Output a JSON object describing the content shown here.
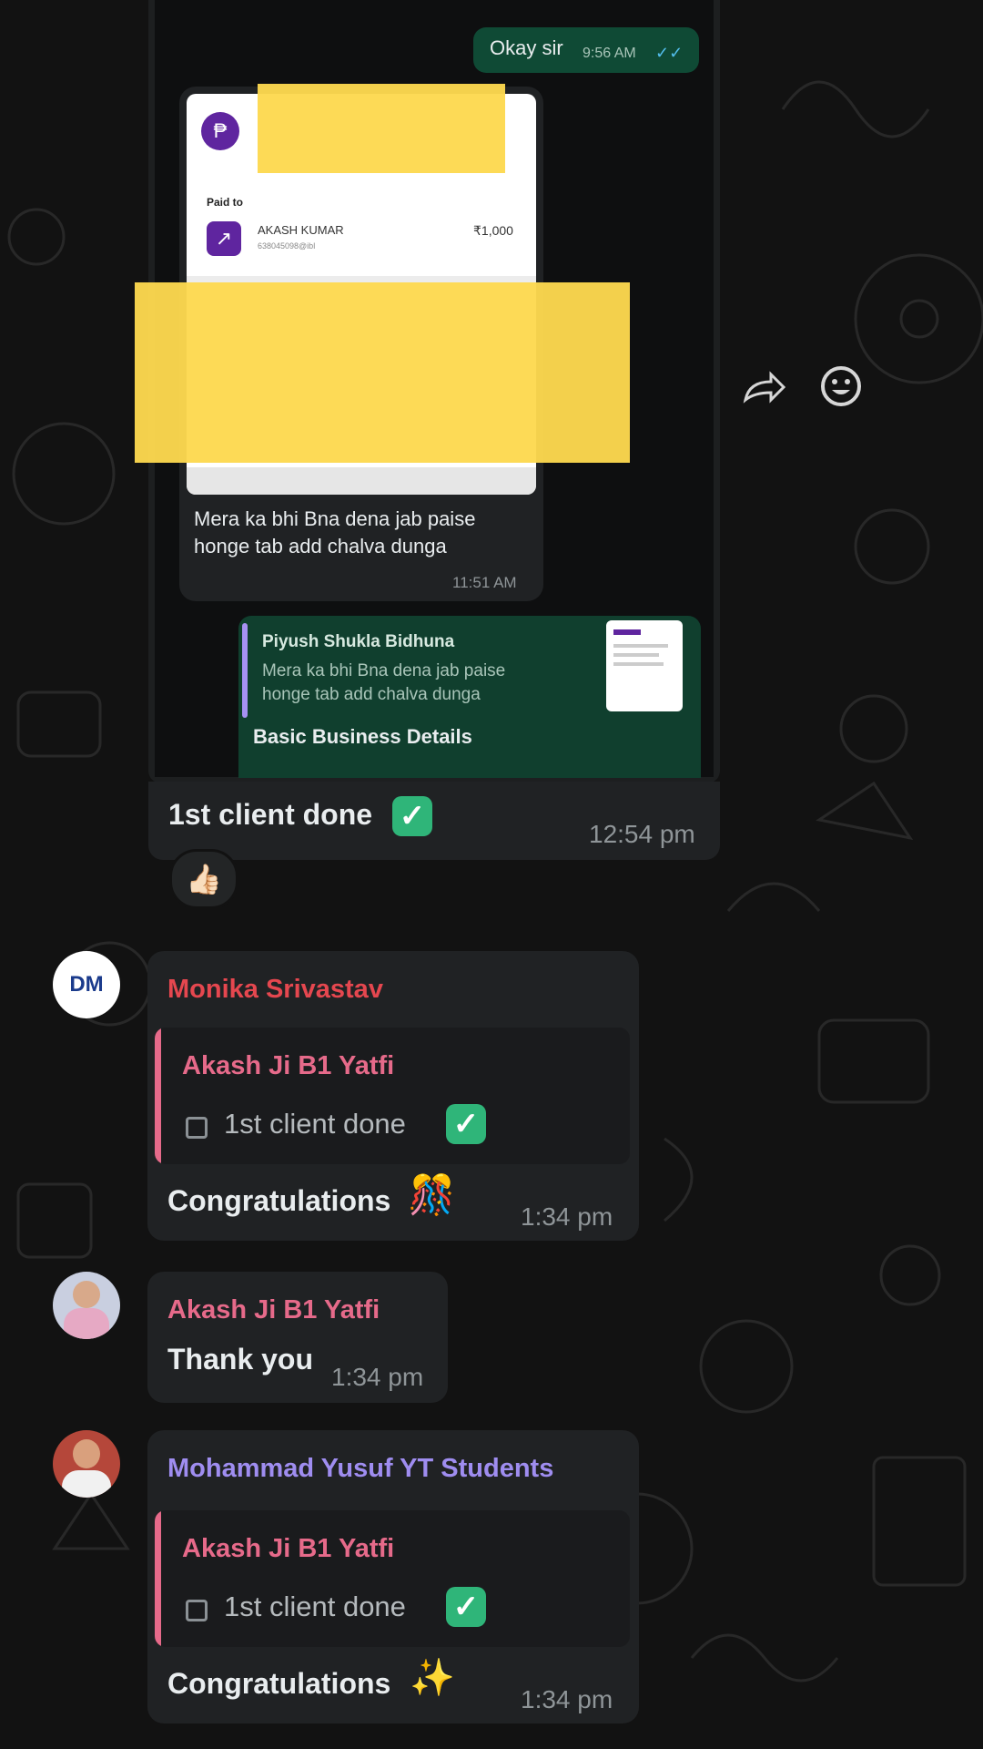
{
  "top_message": {
    "text": "Okay sir",
    "time": "9:56 AM",
    "ticks": "✓✓"
  },
  "payment_card": {
    "paid_to": "Paid to",
    "payee": "AKASH KUMAR",
    "upi": "638045098@ibl",
    "amount": "₹1,000",
    "caption_line1": "Mera ka bhi Bna dena jab paise",
    "caption_line2": "honge tab add chalva dunga",
    "time": "11:51 AM"
  },
  "reply_preview": {
    "sender": "Piyush Shukla Bidhuna",
    "quoted_line1": "Mera ka bhi Bna dena jab paise",
    "quoted_line2": "honge tab add chalva dunga",
    "body": "Basic Business Details"
  },
  "main_message": {
    "text": "1st client done",
    "time": "12:54 pm",
    "reaction": "👍🏻"
  },
  "icons": {
    "forward": "forward-icon",
    "emoji": "emoji-icon"
  },
  "messages": [
    {
      "sender": "Monika Srivastav",
      "sender_color": "#e5474f",
      "quote_sender": "Akash Ji B1 Yatfi",
      "quote_text": "1st client done",
      "text": "Congratulations",
      "emoji": "🎊",
      "time": "1:34 pm",
      "avatar_text": "DM"
    },
    {
      "sender": "Akash Ji B1 Yatfi",
      "sender_color": "#e66a8a",
      "text": "Thank you",
      "time": "1:34 pm"
    },
    {
      "sender": "Mohammad Yusuf YT Students",
      "sender_color": "#9f8df0",
      "quote_sender": "Akash Ji B1 Yatfi",
      "quote_text": "1st client done",
      "text": "Congratulations",
      "emoji": "✨",
      "time": "1:34 pm"
    }
  ]
}
